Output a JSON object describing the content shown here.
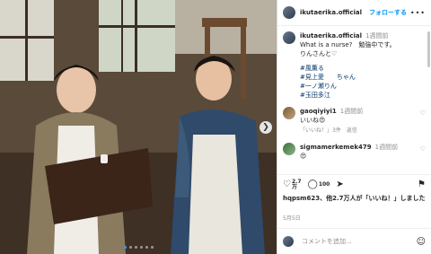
{
  "header": {
    "username": "ikutaerika.official",
    "follow": "フォローする",
    "more": "•••"
  },
  "caption": {
    "username": "ikutaerika.official",
    "time": "1週間前",
    "line1": "What is a nurse?　勉強中です。",
    "line2": "りんさんと♡",
    "tags": [
      "#風薫る",
      "#見上愛　　ちゃん",
      "#一ノ瀬りん",
      "#玉田多江"
    ]
  },
  "comments": [
    {
      "username": "gaoqiyiyi1",
      "time": "1週間前",
      "text": "いいね😍",
      "likes": "「いいね！」3件",
      "reply": "返信"
    },
    {
      "username": "sigmamerkemek479",
      "time": "1週間前",
      "text": "😍",
      "likes": "",
      "reply": ""
    }
  ],
  "actions": {
    "likes_count_1": "2.7",
    "likes_count_2": "万",
    "comments_count": "100"
  },
  "likes_text_user": "hqpsm623、",
  "likes_text_rest": "他2.7万人が「いいね！」しました",
  "date": "5月5日",
  "add_comment_placeholder": "コメントを追加...",
  "icons": {
    "heart": "heart-icon",
    "comment": "comment-icon",
    "share": "share-icon",
    "bookmark": "bookmark-icon",
    "emoji": "emoji-icon",
    "next": "chevron-right-icon"
  },
  "carousel": {
    "count": 6,
    "active": 0
  }
}
